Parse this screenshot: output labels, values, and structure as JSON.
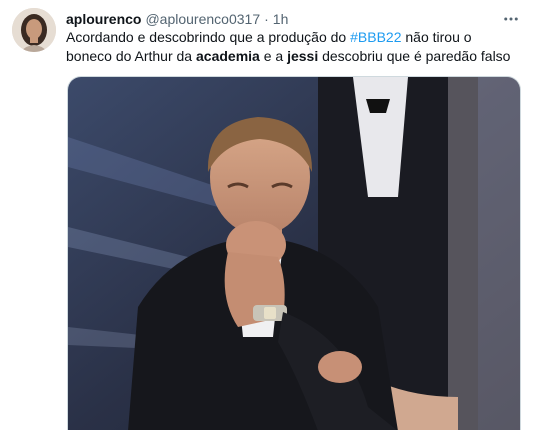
{
  "tweet": {
    "display_name": "aplourenco",
    "handle": "@aplourenco0317",
    "separator": "·",
    "time": "1h",
    "text_parts": {
      "p1": "Acordando e descobrindo que a produção do ",
      "hashtag": "#BBB22",
      "p2": " não tirou o boneco do Arthur da ",
      "bold1": "academia",
      "p3": " e a ",
      "bold2": "jessi",
      "p4": " descobriu que é paredão falso"
    }
  },
  "icons": {
    "more": "more-horizontal-icon",
    "avatar": "avatar"
  }
}
